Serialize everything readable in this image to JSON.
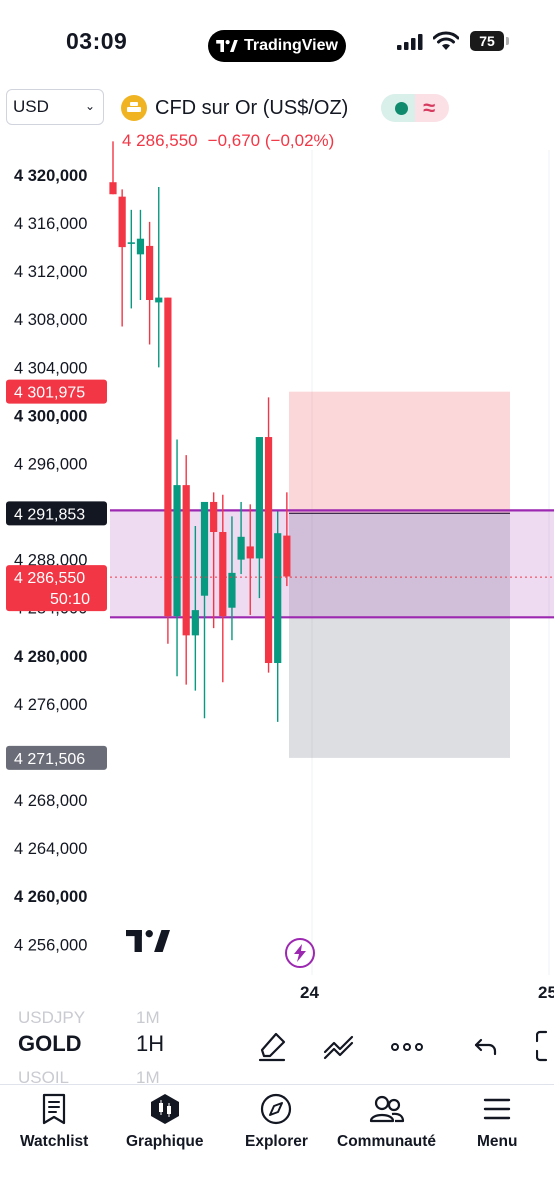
{
  "status_bar": {
    "time": "03:09",
    "app_pill": "TradingView",
    "battery": "75"
  },
  "header": {
    "currency": "USD",
    "symbol_title": "CFD sur Or (US$/OZ)",
    "price": "4 286,550",
    "change": "−0,670",
    "change_pct": "(−0,02%)",
    "colors": {
      "down": "#f23645",
      "up": "#089981",
      "accent": "#9c27b0"
    }
  },
  "chart": {
    "y_axis_ticks": [
      {
        "label": "4 320,000",
        "value": 4320,
        "bold": true
      },
      {
        "label": "4 316,000",
        "value": 4316,
        "bold": false
      },
      {
        "label": "4 312,000",
        "value": 4312,
        "bold": false
      },
      {
        "label": "4 308,000",
        "value": 4308,
        "bold": false
      },
      {
        "label": "4 304,000",
        "value": 4304,
        "bold": false
      },
      {
        "label": "4 300,000",
        "value": 4300,
        "bold": true
      },
      {
        "label": "4 296,000",
        "value": 4296,
        "bold": false
      },
      {
        "label": "4 288,000",
        "value": 4288,
        "bold": false
      },
      {
        "label": "4 284,000",
        "value": 4284,
        "bold": false
      },
      {
        "label": "4 280,000",
        "value": 4280,
        "bold": true
      },
      {
        "label": "4 276,000",
        "value": 4276,
        "bold": false
      },
      {
        "label": "4 272,000",
        "value": 4272,
        "bold": false
      },
      {
        "label": "4 268,000",
        "value": 4268,
        "bold": false
      },
      {
        "label": "4 264,000",
        "value": 4264,
        "bold": false
      },
      {
        "label": "4 260,000",
        "value": 4260,
        "bold": true
      },
      {
        "label": "4 256,000",
        "value": 4256,
        "bold": false
      }
    ],
    "price_tags": [
      {
        "label": "4 301,975",
        "value": 4301.975,
        "color": "#f23645"
      },
      {
        "label": "4 291,853",
        "value": 4291.853,
        "color": "#131722"
      },
      {
        "label": "4 286,550",
        "sublabel": "50:10",
        "value": 4286.55,
        "color": "#f23645"
      },
      {
        "label": "4 271,506",
        "value": 4271.506,
        "color": "#6a6d78"
      }
    ],
    "position_tool": {
      "entry": 4291.853,
      "target": 4301.975,
      "stop": 4271.506
    },
    "zone": {
      "top": 4292.1,
      "bottom": 4283.2
    },
    "dates": [
      "24",
      "25"
    ],
    "candles": [
      {
        "o": 4319.4,
        "h": 4322.8,
        "l": 4318.4,
        "c": 4318.4
      },
      {
        "o": 4318.2,
        "h": 4318.8,
        "l": 4307.4,
        "c": 4314.0
      },
      {
        "o": 4314.4,
        "h": 4317.1,
        "l": 4308.9,
        "c": 4314.4
      },
      {
        "o": 4313.4,
        "h": 4317.1,
        "l": 4309.6,
        "c": 4314.7
      },
      {
        "o": 4314.1,
        "h": 4316.1,
        "l": 4305.9,
        "c": 4309.6
      },
      {
        "o": 4309.4,
        "h": 4319.0,
        "l": 4304.0,
        "c": 4309.8
      },
      {
        "o": 4309.8,
        "h": 4309.8,
        "l": 4281.0,
        "c": 4283.3
      },
      {
        "o": 4283.3,
        "h": 4298.0,
        "l": 4278.3,
        "c": 4294.2
      },
      {
        "o": 4294.2,
        "h": 4296.7,
        "l": 4277.6,
        "c": 4281.7
      },
      {
        "o": 4281.7,
        "h": 4290.8,
        "l": 4277.1,
        "c": 4283.8
      },
      {
        "o": 4285.0,
        "h": 4292.6,
        "l": 4274.8,
        "c": 4292.8
      },
      {
        "o": 4292.8,
        "h": 4293.6,
        "l": 4282.3,
        "c": 4290.3
      },
      {
        "o": 4290.3,
        "h": 4293.4,
        "l": 4277.8,
        "c": 4283.3
      },
      {
        "o": 4284.0,
        "h": 4291.6,
        "l": 4281.3,
        "c": 4286.9
      },
      {
        "o": 4288.0,
        "h": 4292.8,
        "l": 4286.8,
        "c": 4289.9
      },
      {
        "o": 4289.1,
        "h": 4292.6,
        "l": 4283.4,
        "c": 4288.1
      },
      {
        "o": 4288.1,
        "h": 4290.3,
        "l": 4284.8,
        "c": 4298.2
      },
      {
        "o": 4298.2,
        "h": 4301.5,
        "l": 4278.6,
        "c": 4279.4
      },
      {
        "o": 4279.4,
        "h": 4292.0,
        "l": 4274.5,
        "c": 4290.2
      },
      {
        "o": 4290.0,
        "h": 4293.6,
        "l": 4285.8,
        "c": 4286.6
      }
    ]
  },
  "toolbar": {
    "symbols": [
      "USDJPY",
      "GOLD",
      "USOIL"
    ],
    "timeframes": [
      "1M",
      "1H",
      "1M"
    ]
  },
  "tabs": [
    {
      "label": "Watchlist",
      "icon": "watchlist-icon"
    },
    {
      "label": "Graphique",
      "icon": "chart-icon"
    },
    {
      "label": "Explorer",
      "icon": "compass-icon"
    },
    {
      "label": "Communauté",
      "icon": "community-icon"
    },
    {
      "label": "Menu",
      "icon": "menu-icon"
    }
  ]
}
